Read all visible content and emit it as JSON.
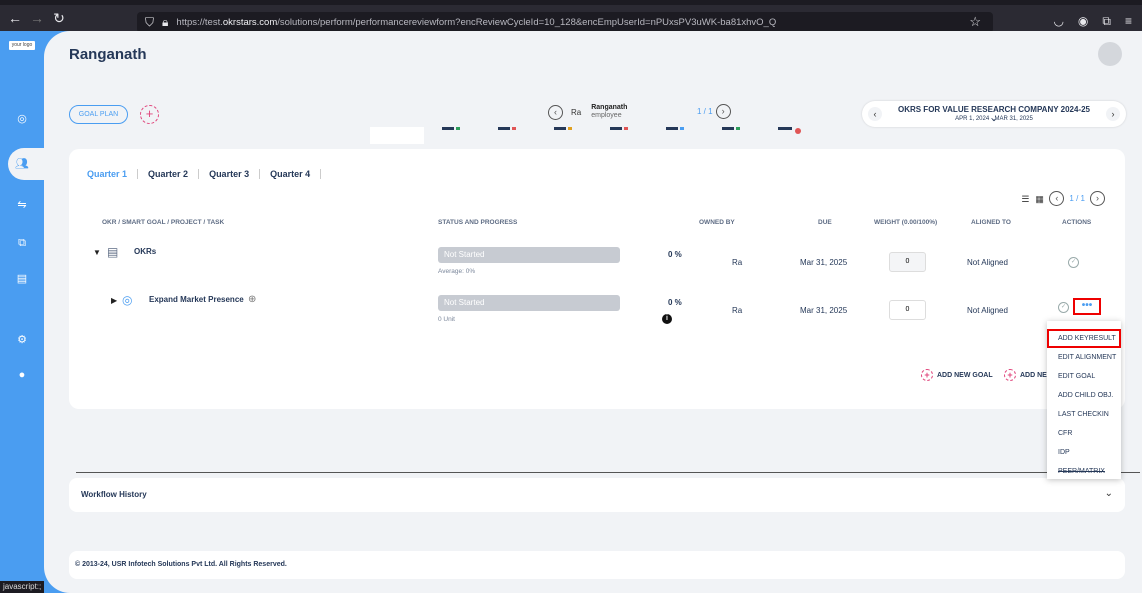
{
  "browser": {
    "url_prefix": "https://test.",
    "url_domain": "okrstars.com",
    "url_path": "/solutions/perform/performancereviewform?encReviewCycleId=10_128&encEmpUserId=nPUxsPV3uWK-ba81xhvO_Q",
    "status_text": "javascript:;"
  },
  "logo_text": "your logo",
  "page": {
    "title": "Ranganath"
  },
  "goal_plan_label": "GOAL PLAN",
  "user_nav": {
    "initials": "Ra",
    "name": "Ranganath",
    "role": "employee",
    "page": "1 / 1"
  },
  "cycle": {
    "title": "OKRS FOR VALUE RESEARCH COMPANY 2024-25",
    "dates": "APR 1, 2024 - MAR 31, 2025"
  },
  "quarters": [
    "Quarter 1",
    "Quarter 2",
    "Quarter 3",
    "Quarter 4"
  ],
  "pagination": "1 / 1",
  "columns": {
    "okr": "OKR / SMART GOAL / PROJECT / TASK",
    "status": "STATUS AND PROGRESS",
    "owned": "OWNED BY",
    "due": "DUE",
    "weight": "WEIGHT (0.00/100%)",
    "aligned": "ALIGNED TO",
    "actions": "ACTIONS"
  },
  "rows": [
    {
      "title": "OKRs",
      "status": "Not Started",
      "sub": "Average: 0%",
      "percent": "0 %",
      "owner": "Ra",
      "due": "Mar 31, 2025",
      "weight": "0",
      "aligned": "Not Aligned"
    },
    {
      "title": "Expand Market Presence",
      "status": "Not Started",
      "sub": "0 Unit",
      "percent": "0 %",
      "owner": "Ra",
      "due": "Mar 31, 2025",
      "weight": "0",
      "aligned": "Not Aligned"
    }
  ],
  "add_new_goal": "ADD NEW GOAL",
  "add_new_truncated": "ADD NE",
  "dropdown": [
    "ADD KEYRESULT",
    "EDIT ALIGNMENT",
    "EDIT GOAL",
    "ADD CHILD OBJ.",
    "LAST CHECKIN",
    "CFR",
    "IDP",
    "PEER/MATRIX"
  ],
  "workflow_label": "Workflow History",
  "footer": "© 2013-24, USR Infotech Solutions Pvt Ltd. All Rights Reserved.",
  "colors": {
    "accent": "#4a9df1",
    "highlight": "#e00000",
    "add": "#e0467c"
  }
}
